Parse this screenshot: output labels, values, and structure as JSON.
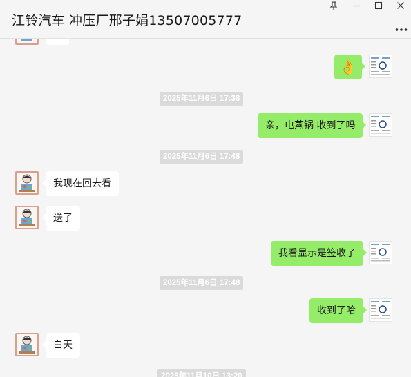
{
  "window": {
    "title": "江铃汽车 冲压厂邢子娟13507005777",
    "pin_icon": "pin-icon",
    "minimize_icon": "minimize-icon",
    "maximize_icon": "maximize-icon",
    "close_icon": "close-icon",
    "more_icon": "more-icon"
  },
  "messages": [
    {
      "side": "out",
      "type": "emoji",
      "text": "👌"
    },
    {
      "side": "time",
      "text": "2025年11月6日 17:38"
    },
    {
      "side": "out",
      "text": "亲，电蒸锅 收到了吗"
    },
    {
      "side": "time",
      "text": "2025年11月6日 17:48"
    },
    {
      "side": "in",
      "text": "我现在回去看"
    },
    {
      "side": "in",
      "text": "送了"
    },
    {
      "side": "out",
      "text": "我看显示是签收了"
    },
    {
      "side": "time",
      "text": "2025年11月6日 17:48"
    },
    {
      "side": "out",
      "text": "收到了哈"
    },
    {
      "side": "in",
      "text": "白天"
    },
    {
      "side": "time",
      "text": "2025年11月10日 13:20"
    }
  ],
  "colors": {
    "outgoing_bubble": "#95ec69",
    "incoming_bubble": "#ffffff",
    "background": "#f5f5f5",
    "timestamp_bg": "#dadada"
  }
}
